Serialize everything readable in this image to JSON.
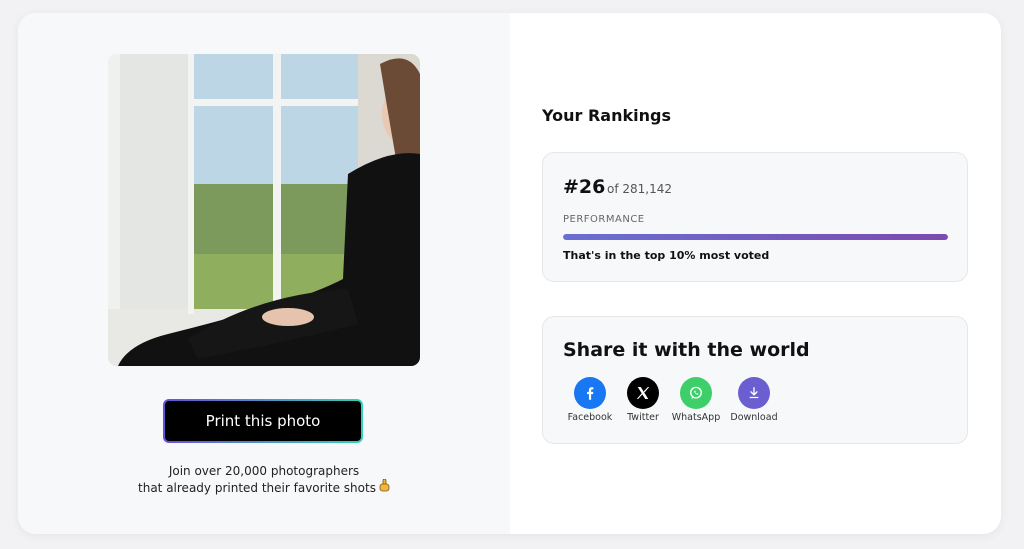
{
  "print_button": {
    "label": "Print this photo"
  },
  "join": {
    "line1": "Join over 20,000 photographers",
    "line2": "that already printed their favorite shots"
  },
  "rankings": {
    "title": "Your Rankings",
    "rank": "#26",
    "of_total": "of 281,142",
    "performance_label": "PERFORMANCE",
    "performance_fraction": 1.0,
    "performance_text": "That's in the top 10% most voted"
  },
  "share": {
    "title": "Share it with the world",
    "items": [
      {
        "label": "Facebook",
        "icon": "facebook-icon",
        "color": "#1877f2"
      },
      {
        "label": "Twitter",
        "icon": "x-icon",
        "color": "#000000"
      },
      {
        "label": "WhatsApp",
        "icon": "whatsapp-icon",
        "color": "#3ecf6a"
      },
      {
        "label": "Download",
        "icon": "download-icon",
        "color": "#6a5ed1"
      }
    ]
  },
  "colors": {
    "accent_gradient_start": "#6a6fd2",
    "accent_gradient_end": "#7d4ab0",
    "button_border_start": "#6a4fd9",
    "button_border_end": "#34d1b7"
  }
}
